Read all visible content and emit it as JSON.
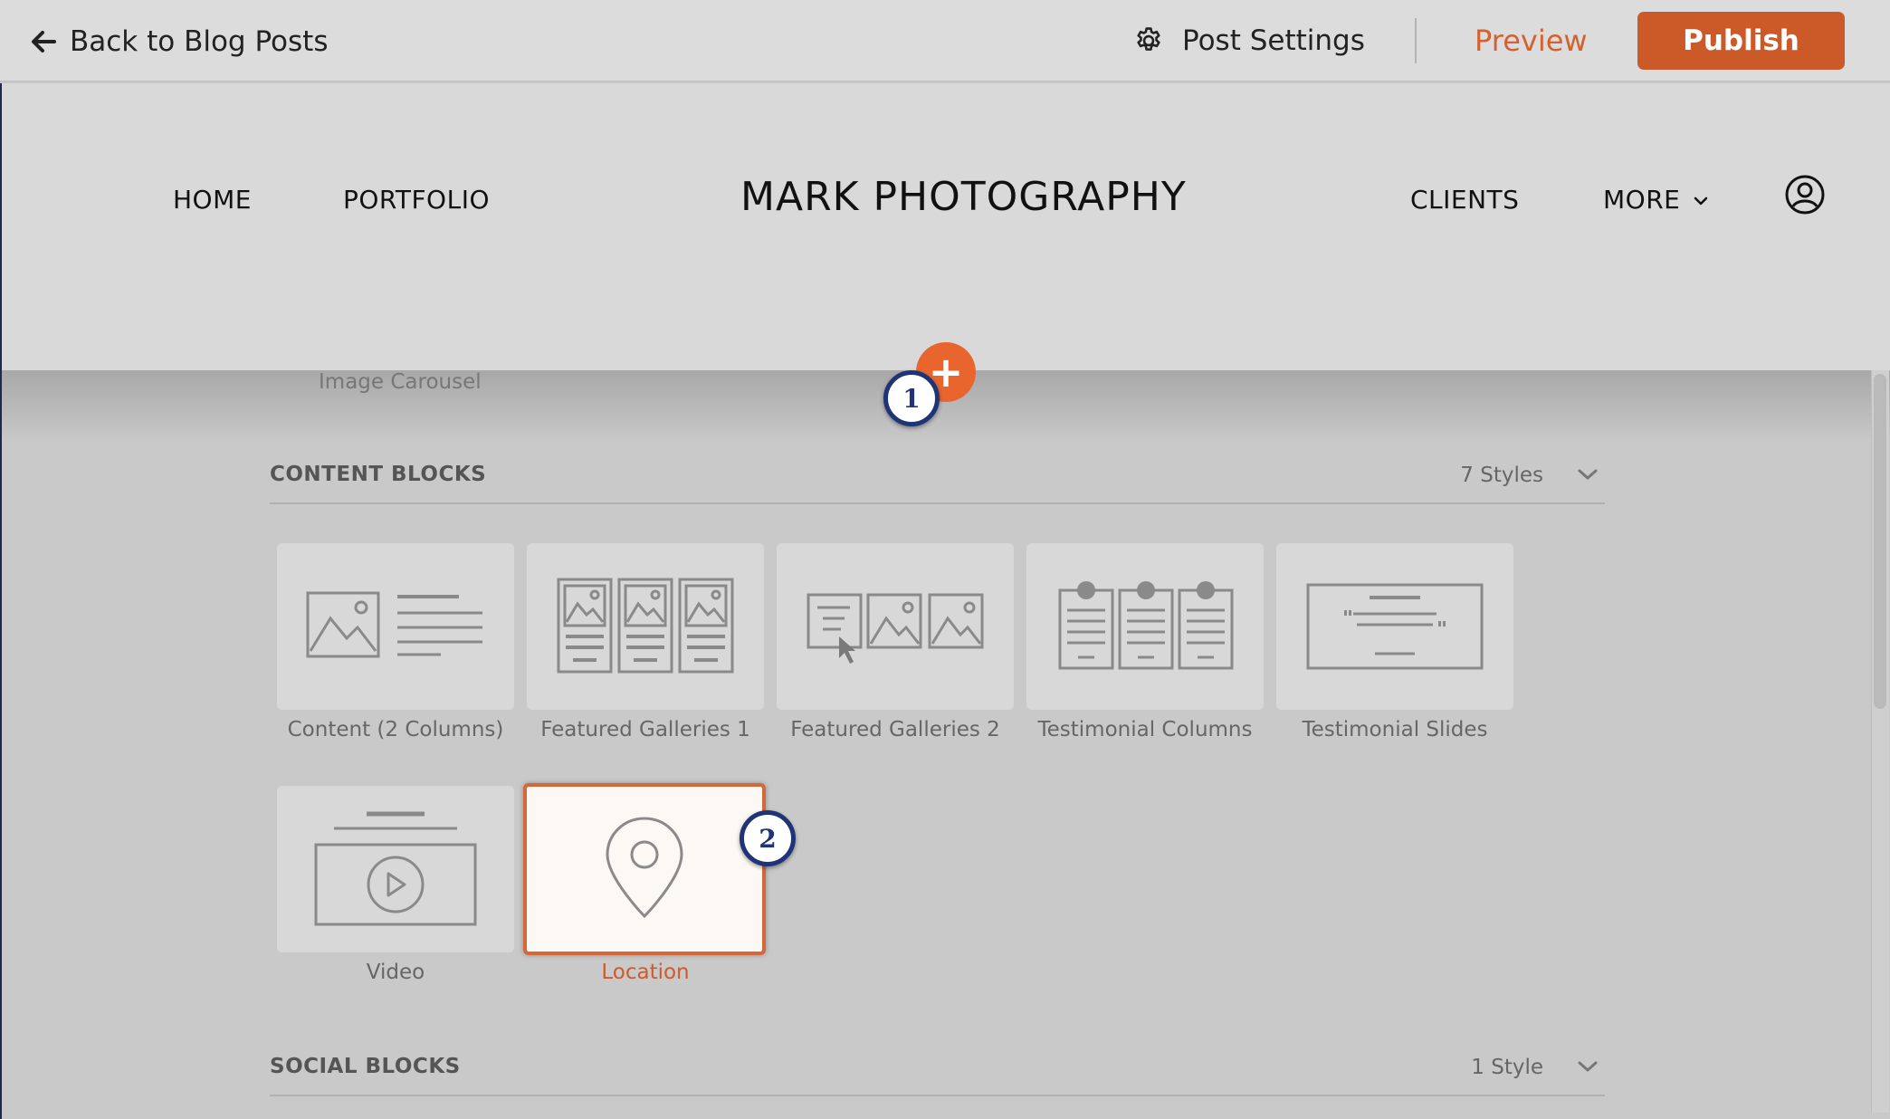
{
  "topbar": {
    "back_label": "Back to Blog Posts",
    "post_settings_label": "Post Settings",
    "preview_label": "Preview",
    "publish_label": "Publish"
  },
  "site": {
    "title": "MARK PHOTOGRAPHY",
    "nav": {
      "home": "HOME",
      "portfolio": "PORTFOLIO",
      "clients": "CLIENTS",
      "more": "MORE"
    }
  },
  "panel": {
    "partial_label": "Image Carousel",
    "content_blocks": {
      "title": "CONTENT BLOCKS",
      "count": "7 Styles",
      "items": [
        {
          "label": "Content (2 Columns)"
        },
        {
          "label": "Featured Galleries 1"
        },
        {
          "label": "Featured Galleries 2"
        },
        {
          "label": "Testimonial Columns"
        },
        {
          "label": "Testimonial Slides"
        },
        {
          "label": "Video"
        },
        {
          "label": "Location"
        }
      ]
    },
    "social_blocks": {
      "title": "SOCIAL BLOCKS",
      "count": "1 Style"
    }
  },
  "annotations": {
    "step1": "1",
    "step2": "2",
    "add_symbol": "+"
  },
  "colors": {
    "accent": "#cc5a29",
    "badge": "#1e3477"
  }
}
